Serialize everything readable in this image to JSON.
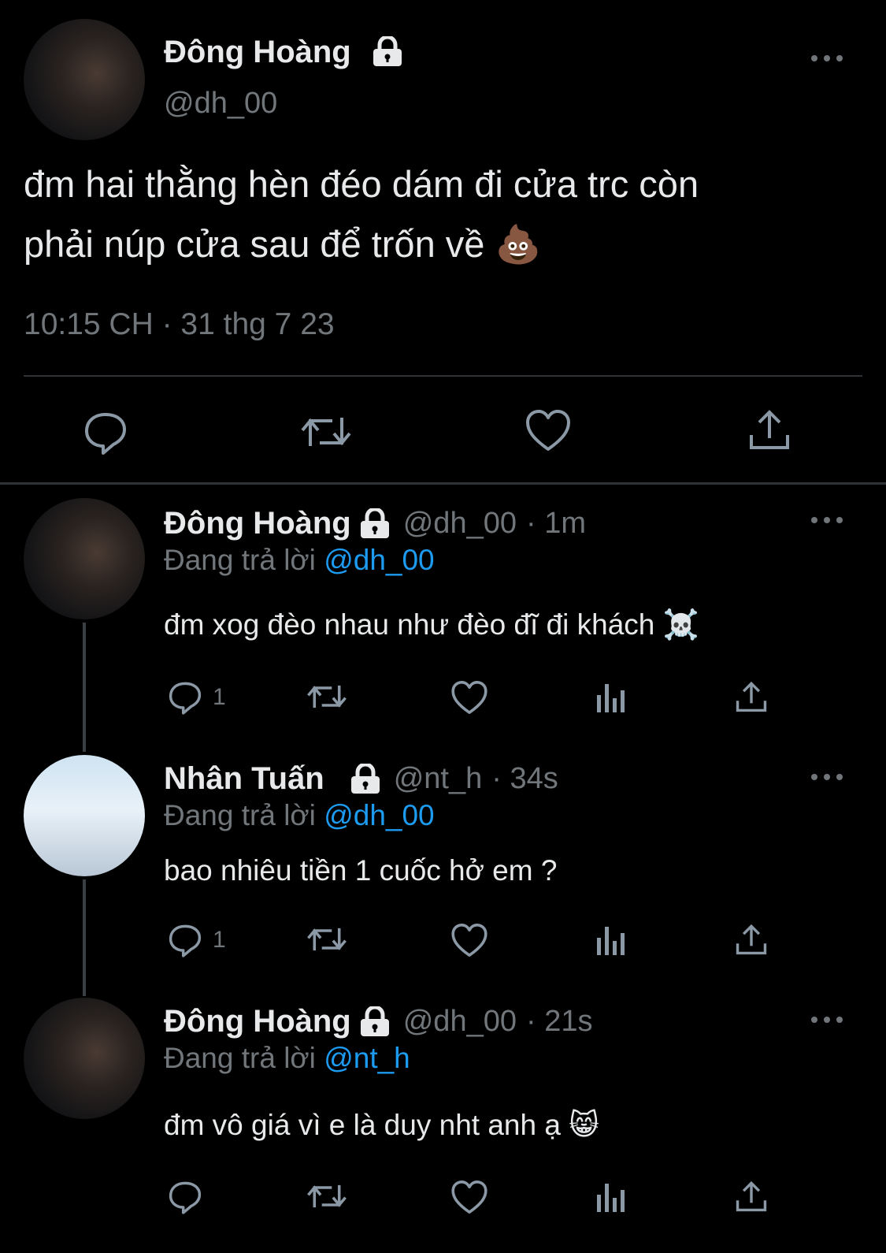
{
  "main_tweet": {
    "name": "Đông Hoàng",
    "handle": "@dh_00",
    "text_line1": "đm hai thằng hèn đéo dám đi cửa trc còn",
    "text_line2": "phải núp cửa sau để trốn về",
    "emoji": "💩",
    "timestamp": "10:15 CH · 31 thg 7 23",
    "actions": [
      "reply-icon",
      "retweet-icon",
      "like-icon",
      "share-icon"
    ]
  },
  "replies": [
    {
      "name": "Đông Hoàng",
      "handle": "@dh_00",
      "time": "· 1m",
      "replying_label": "Đang trả lời",
      "replying_to": "@dh_00",
      "text": "đm xog đèo nhau như đèo đĩ đi khách",
      "emoji": "☠️",
      "reply_count": "1"
    },
    {
      "name": "Nhân Tuấn",
      "handle": "@nt_h",
      "time": "· 34s",
      "replying_label": "Đang trả lời",
      "replying_to": "@dh_00",
      "text": "bao nhiêu tiền 1 cuốc hở em ?",
      "emoji": "",
      "reply_count": "1"
    },
    {
      "name": "Đông Hoàng",
      "handle": "@dh_00",
      "time": "· 21s",
      "replying_label": "Đang trả lời",
      "replying_to": "@nt_h",
      "text": "đm vô giá vì e là duy nht anh ạ",
      "emoji": "😸",
      "reply_count": ""
    }
  ],
  "colors": {
    "background": "#000000",
    "text": "#e7e9ea",
    "muted": "#71767b",
    "link": "#1d9bf0"
  }
}
